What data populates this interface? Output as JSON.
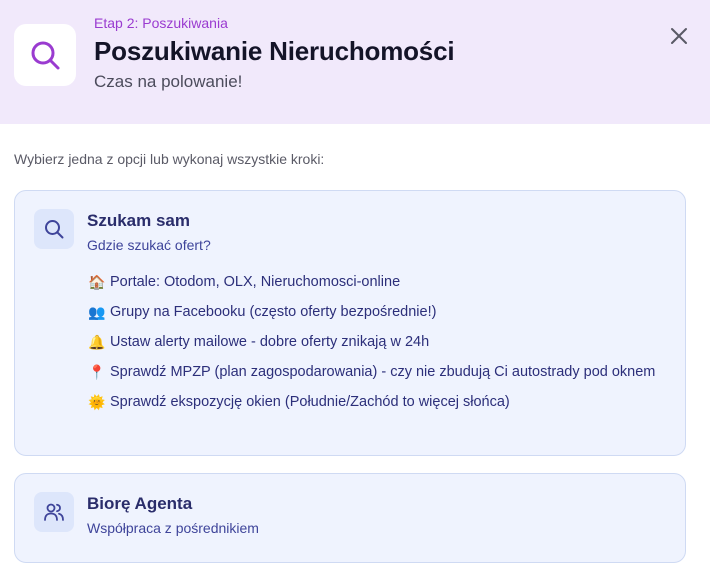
{
  "header": {
    "stage": "Etap 2: Poszukiwania",
    "title": "Poszukiwanie Nieruchomości",
    "subtitle": "Czas na polowanie!",
    "icon": "search-icon",
    "close_icon": "close-icon",
    "background": "#f1e9fb",
    "accent": "#9a3bd0"
  },
  "intro": "Wybierz jedna z opcji lub wykonaj wszystkie kroki:",
  "cards": [
    {
      "icon": "search-icon",
      "title": "Szukam sam",
      "subtitle": "Gdzie szukać ofert?",
      "items": [
        {
          "emoji": "🏠",
          "text": "Portale: Otodom, OLX, Nieruchomosci-online"
        },
        {
          "emoji": "👥",
          "text": "Grupy na Facebooku (często oferty bezpośrednie!)"
        },
        {
          "emoji": "🔔",
          "text": "Ustaw alerty mailowe - dobre oferty znikają w 24h"
        },
        {
          "emoji": "📍",
          "text": "Sprawdź MPZP (plan zagospodarowania) - czy nie zbudują Ci autostrady pod oknem"
        },
        {
          "emoji": "🌞",
          "text": "Sprawdź ekspozycję okien (Południe/Zachód to więcej słońca)"
        }
      ]
    },
    {
      "icon": "users-icon",
      "title": "Biorę Agenta",
      "subtitle": "Współpraca z pośrednikiem"
    }
  ],
  "colors": {
    "card_bg": "#eff3fe",
    "card_border": "#cfdaf3",
    "card_text": "#2c2f7a"
  }
}
